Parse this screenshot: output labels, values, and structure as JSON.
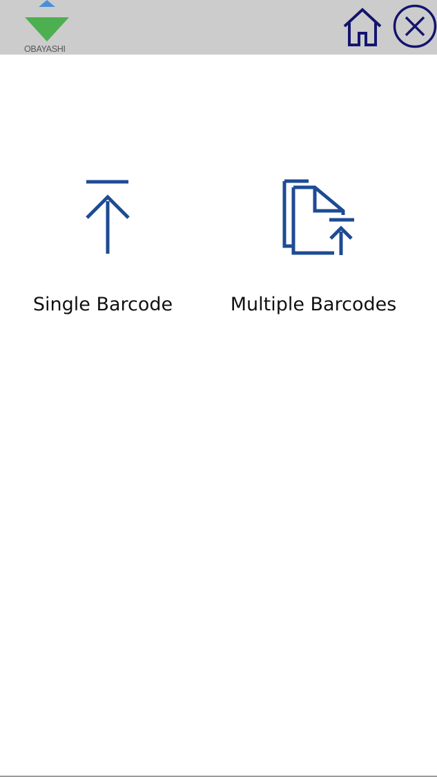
{
  "header": {
    "logo_text": "OBAYASHI",
    "home_icon": "home-icon",
    "close_icon": "close-circle-icon"
  },
  "actions": [
    {
      "label": "Single Barcode",
      "icon": "upload-arrow-icon"
    },
    {
      "label": "Multiple Barcodes",
      "icon": "documents-upload-icon"
    }
  ],
  "colors": {
    "header_bg": "#cccccc",
    "icon_blue": "#1e4b94",
    "nav_icon_navy": "#14146e",
    "logo_green": "#4caf50",
    "logo_blue": "#4a90d9"
  }
}
